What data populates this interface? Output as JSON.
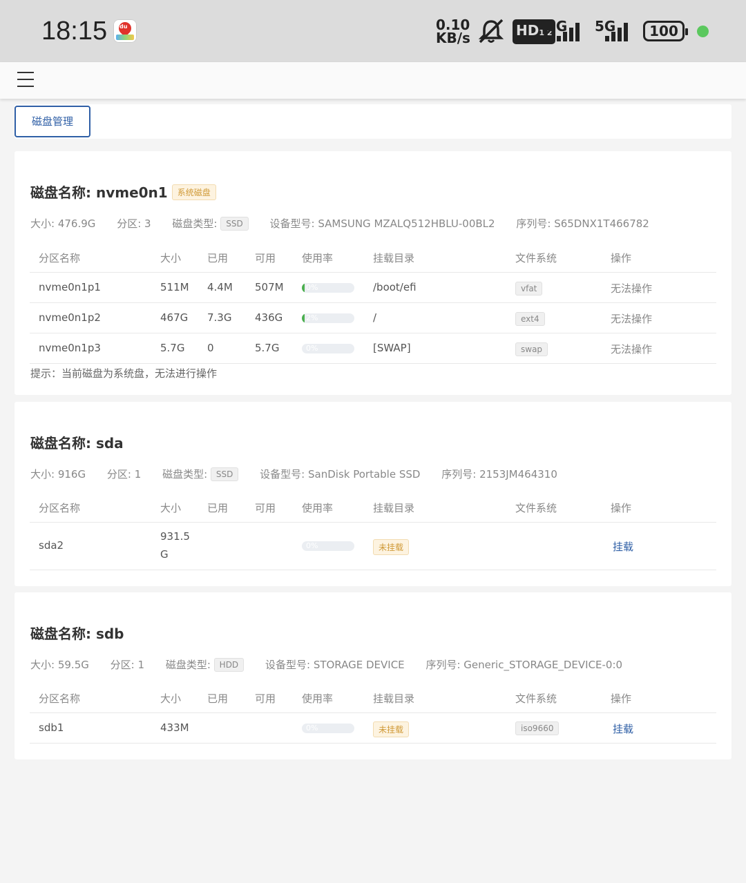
{
  "status_bar": {
    "time": "18:15",
    "app_icon": "map-pin-icon",
    "net_speed_value": "0.10",
    "net_speed_unit": "KB/s",
    "hd_label": "HD",
    "hd_sub": "1 2",
    "sim1_label": "5G",
    "sim2_label": "5G",
    "battery": "100",
    "accent_dot_color": "#5bc85e"
  },
  "nav": {
    "menu_icon": "hamburger-menu-icon"
  },
  "tabs": [
    {
      "label": "磁盘管理"
    }
  ],
  "table_headers": [
    "分区名称",
    "大小",
    "已用",
    "可用",
    "使用率",
    "挂载目录",
    "文件系统",
    "操作"
  ],
  "meta_labels": {
    "size": "大小:",
    "partitions": "分区:",
    "disk_type": "磁盘类型:",
    "model": "设备型号:",
    "serial": "序列号:"
  },
  "disks": [
    {
      "title": "磁盘名称: nvme0n1",
      "badge": "系统磁盘",
      "size": "476.9G",
      "partitions": "3",
      "disk_type": "SSD",
      "model": "SAMSUNG MZALQ512HBLU-00BL2",
      "serial": "S65DNX1T466782",
      "rows": [
        {
          "name": "nvme0n1p1",
          "size": "511M",
          "used": "4.4M",
          "avail": "507M",
          "usage": "0%",
          "usage_fraction": 0.01,
          "mount": "/boot/efi",
          "fs": "vfat",
          "op": "无法操作"
        },
        {
          "name": "nvme0n1p2",
          "size": "467G",
          "used": "7.3G",
          "avail": "436G",
          "usage": "2%",
          "usage_fraction": 0.02,
          "mount": "/",
          "fs": "ext4",
          "op": "无法操作"
        },
        {
          "name": "nvme0n1p3",
          "size": "5.7G",
          "used": "0",
          "avail": "5.7G",
          "usage": "0%",
          "usage_fraction": 0.0,
          "mount": "[SWAP]",
          "fs": "swap",
          "op": "无法操作"
        }
      ],
      "hint": "提示：当前磁盘为系统盘，无法进行操作"
    },
    {
      "title": "磁盘名称: sda",
      "size": "916G",
      "partitions": "1",
      "disk_type": "SSD",
      "model": "SanDisk Portable SSD",
      "serial": "2153JM464310",
      "rows": [
        {
          "name": "sda2",
          "size_line1": "931.5",
          "size_line2": "G",
          "usage": "0%",
          "usage_fraction": 0.0,
          "mount_status": "未挂载",
          "op": "挂载"
        }
      ]
    },
    {
      "title": "磁盘名称: sdb",
      "size": "59.5G",
      "partitions": "1",
      "disk_type": "HDD",
      "model": "STORAGE DEVICE",
      "serial": "Generic_STORAGE_DEVICE-0:0",
      "rows": [
        {
          "name": "sdb1",
          "size": "433M",
          "usage": "0%",
          "usage_fraction": 0.0,
          "mount_status": "未挂载",
          "fs": "iso9660",
          "op": "挂载"
        }
      ]
    }
  ]
}
